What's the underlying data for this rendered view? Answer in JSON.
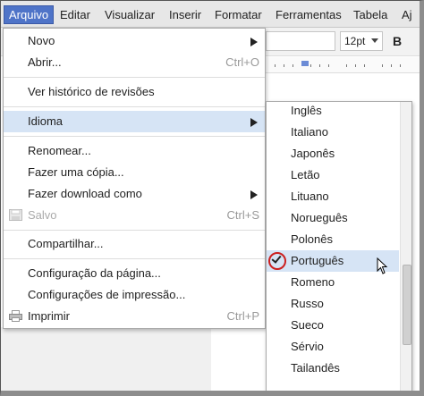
{
  "menubar": {
    "items": [
      "Arquivo",
      "Editar",
      "Visualizar",
      "Inserir",
      "Formatar",
      "Ferramentas",
      "Tabela",
      "Aj"
    ]
  },
  "toolbar": {
    "font_size": "12pt",
    "bold": "B"
  },
  "arquivo_menu": {
    "items": [
      {
        "label": "Novo",
        "shortcut": ""
      },
      {
        "label": "Abrir...",
        "shortcut": "Ctrl+O"
      },
      {
        "label": "Ver histórico de revisões",
        "shortcut": ""
      },
      {
        "label": "Idioma",
        "shortcut": ""
      },
      {
        "label": "Renomear...",
        "shortcut": ""
      },
      {
        "label": "Fazer uma cópia...",
        "shortcut": ""
      },
      {
        "label": "Fazer download como",
        "shortcut": ""
      },
      {
        "label": "Salvo",
        "shortcut": "Ctrl+S"
      },
      {
        "label": "Compartilhar...",
        "shortcut": ""
      },
      {
        "label": "Configuração da página...",
        "shortcut": ""
      },
      {
        "label": "Configurações de impressão...",
        "shortcut": ""
      },
      {
        "label": "Imprimir",
        "shortcut": "Ctrl+P"
      }
    ]
  },
  "idioma_menu": {
    "items": [
      "Inglês",
      "Italiano",
      "Japonês",
      "Letão",
      "Lituano",
      "Norueguês",
      "Polonês",
      "Português",
      "Romeno",
      "Russo",
      "Sueco",
      "Sérvio",
      "Tailandês"
    ],
    "selected": "Português"
  },
  "colors": {
    "menu_active": "#4f74c8",
    "highlight": "#d6e4f5",
    "annotation_circle": "#cc1f1f"
  }
}
